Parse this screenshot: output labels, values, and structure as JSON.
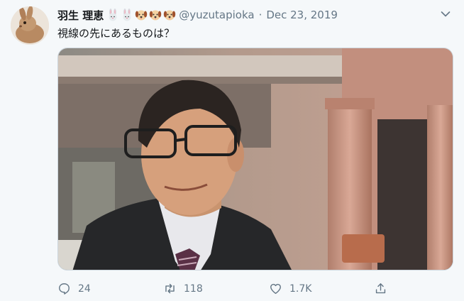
{
  "tweet": {
    "display_name": "羽生 理恵",
    "name_emoji": [
      "rabbit-face-emoji",
      "rabbit-face-emoji",
      "dog-face-emoji",
      "dog-face-emoji",
      "dog-face-emoji"
    ],
    "handle": "@yuzutapioka",
    "separator": "·",
    "date": "Dec 23, 2019",
    "text": "視線の先にあるものは？",
    "actions": {
      "reply_count": "24",
      "retweet_count": "118",
      "like_count": "1.7K"
    }
  },
  "icons": {
    "more": "chevron-down-icon",
    "reply": "reply-icon",
    "retweet": "retweet-icon",
    "like": "heart-icon",
    "share": "share-icon"
  },
  "colors": {
    "background": "#f5f8fa",
    "primary_text": "#14171a",
    "secondary_text": "#657786"
  }
}
